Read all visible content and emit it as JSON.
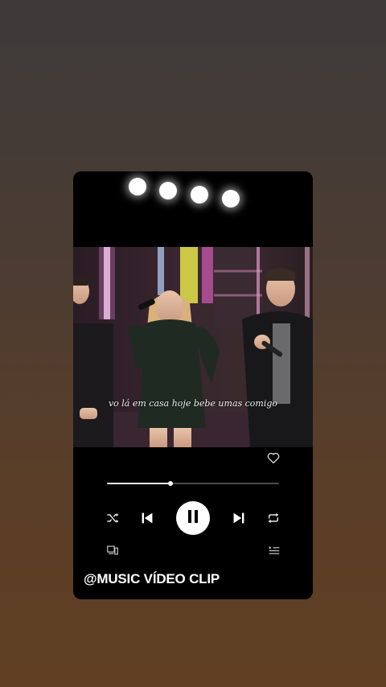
{
  "post": {
    "caption": "@MUSIC VÍDEO CLIP"
  },
  "video": {
    "subtitle": "vo lá em casa hoje bebe umas comigo"
  },
  "player": {
    "progress_fraction": 0.37,
    "liked": false,
    "state": "playing",
    "icons": {
      "like": "heart-outline-icon",
      "shuffle": "shuffle-icon",
      "previous": "skip-previous-icon",
      "pause": "pause-icon",
      "next": "skip-next-icon",
      "repeat": "repeat-icon",
      "devices": "connect-device-icon",
      "queue": "queue-icon"
    }
  },
  "colors": {
    "card_background": "#000000",
    "control_icon": "#ffffff",
    "progress_fill": "#e6e6e6",
    "progress_track": "#4a4a4a"
  }
}
